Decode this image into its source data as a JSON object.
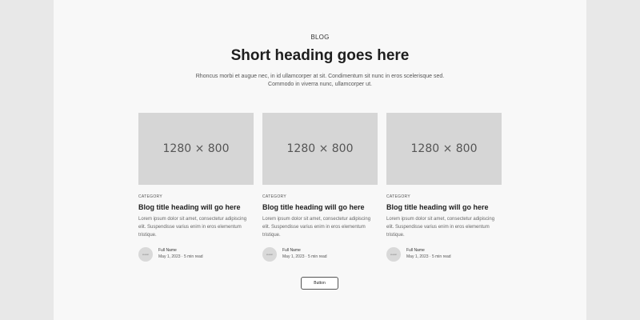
{
  "section": {
    "eyebrow": "BLOG",
    "heading": "Short heading goes here",
    "subtext": "Rhoncus morbi et augue nec, in id ullamcorper at sit. Condimentum sit nunc in eros scelerisque sed. Commodo in viverra nunc, ullamcorper ut."
  },
  "posts": [
    {
      "image_label": "1280 × 800",
      "category": "CATEGORY",
      "title": "Blog title heading will go here",
      "excerpt": "Lorem ipsum dolor sit amet, consectetur adipiscing elit. Suspendisse varius enim in eros elementum tristique.",
      "author_name": "Full Name",
      "meta": "May 1, 2023 · 5 min read",
      "avatar_label": "avatar"
    },
    {
      "image_label": "1280 × 800",
      "category": "CATEGORY",
      "title": "Blog title heading will go here",
      "excerpt": "Lorem ipsum dolor sit amet, consectetur adipiscing elit. Suspendisse varius enim in eros elementum tristique.",
      "author_name": "Full Name",
      "meta": "May 1, 2023 · 5 min read",
      "avatar_label": "avatar"
    },
    {
      "image_label": "1280 × 800",
      "category": "CATEGORY",
      "title": "Blog title heading will go here",
      "excerpt": "Lorem ipsum dolor sit amet, consectetur adipiscing elit. Suspendisse varius enim in eros elementum tristique.",
      "author_name": "Full Name",
      "meta": "May 1, 2023 · 5 min read",
      "avatar_label": "avatar"
    }
  ],
  "button": {
    "label": "Button"
  }
}
